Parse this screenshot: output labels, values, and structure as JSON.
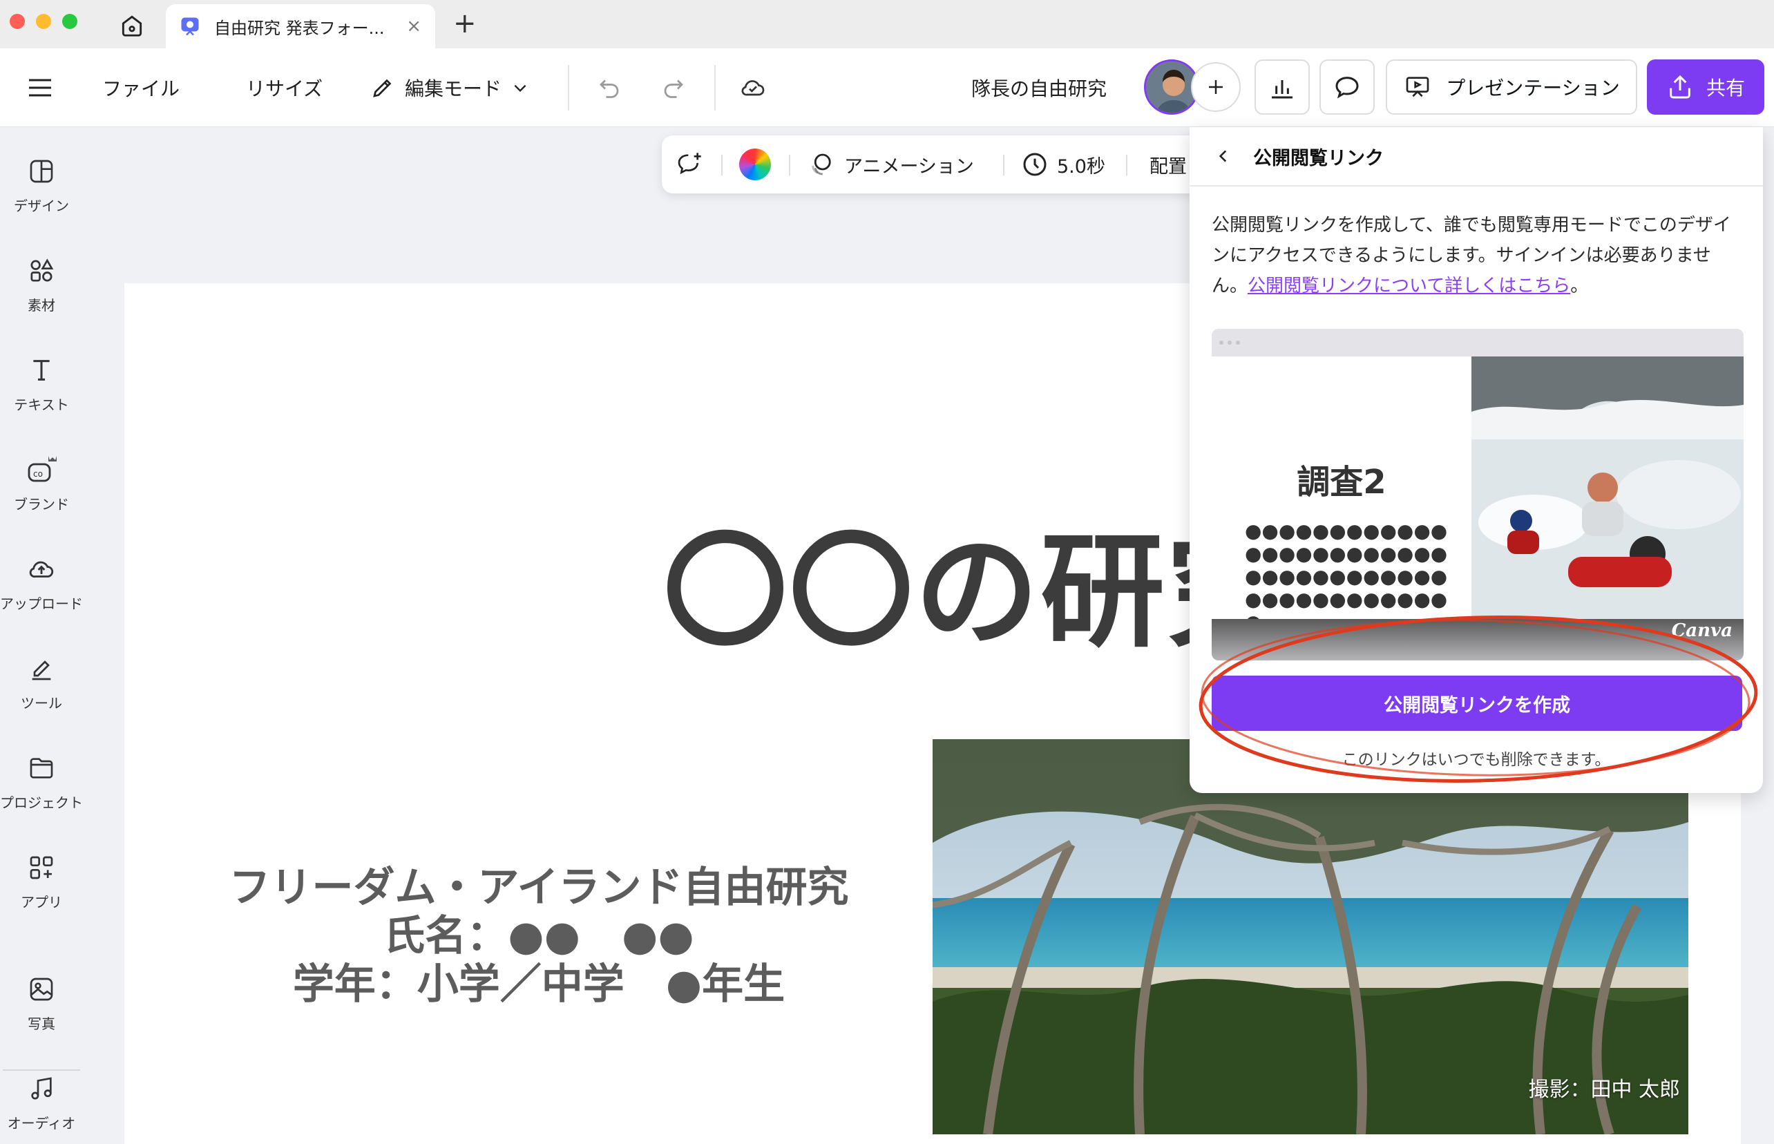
{
  "browser": {
    "tab_title": "自由研究 発表フォー...",
    "tab_close": "×",
    "new_tab": "+"
  },
  "toolbar": {
    "file": "ファイル",
    "resize": "リサイズ",
    "edit_mode": "編集モード",
    "design_name": "隊長の自由研究",
    "present": "プレゼンテーション",
    "share": "共有"
  },
  "sidebar": {
    "items": [
      {
        "label": "デザイン",
        "icon": "design-icon"
      },
      {
        "label": "素材",
        "icon": "elements-icon"
      },
      {
        "label": "テキスト",
        "icon": "text-icon"
      },
      {
        "label": "ブランド",
        "icon": "brand-icon"
      },
      {
        "label": "アップロード",
        "icon": "upload-icon"
      },
      {
        "label": "ツール",
        "icon": "tools-icon"
      },
      {
        "label": "プロジェクト",
        "icon": "projects-icon"
      },
      {
        "label": "アプリ",
        "icon": "apps-icon"
      },
      {
        "label": "写真",
        "icon": "photos-icon"
      },
      {
        "label": "オーディオ",
        "icon": "audio-icon"
      }
    ]
  },
  "context_toolbar": {
    "animation": "アニメーション",
    "duration": "5.0秒",
    "position": "配置"
  },
  "canvas": {
    "title": "〇〇の研究",
    "subtitle_lines": [
      "フリーダム・アイランド自由研究",
      "氏名：●●　●●",
      "学年：小学／中学　●年生"
    ],
    "photo_credit": "撮影：田中 太郎"
  },
  "share_panel": {
    "title": "公開閲覧リンク",
    "description": "公開閲覧リンクを作成して、誰でも閲覧専用モードでこのデザインにアクセスできるようにします。サインインは必要ありません。",
    "learn_more": "公開閲覧リンクについて詳しくはこちら",
    "description_end": "。",
    "preview_title": "調査2",
    "preview_dots": "●●●●●●●●●●●●●●●●●●●●●●●●●●●●●●●●●●●●●●●●●●●●●●●●●。",
    "preview_logo": "Canva",
    "create_button": "公開閲覧リンクを作成",
    "note": "このリンクはいつでも削除できます。"
  },
  "colors": {
    "accent": "#7d3bf2",
    "annotation": "#e03a1e"
  }
}
